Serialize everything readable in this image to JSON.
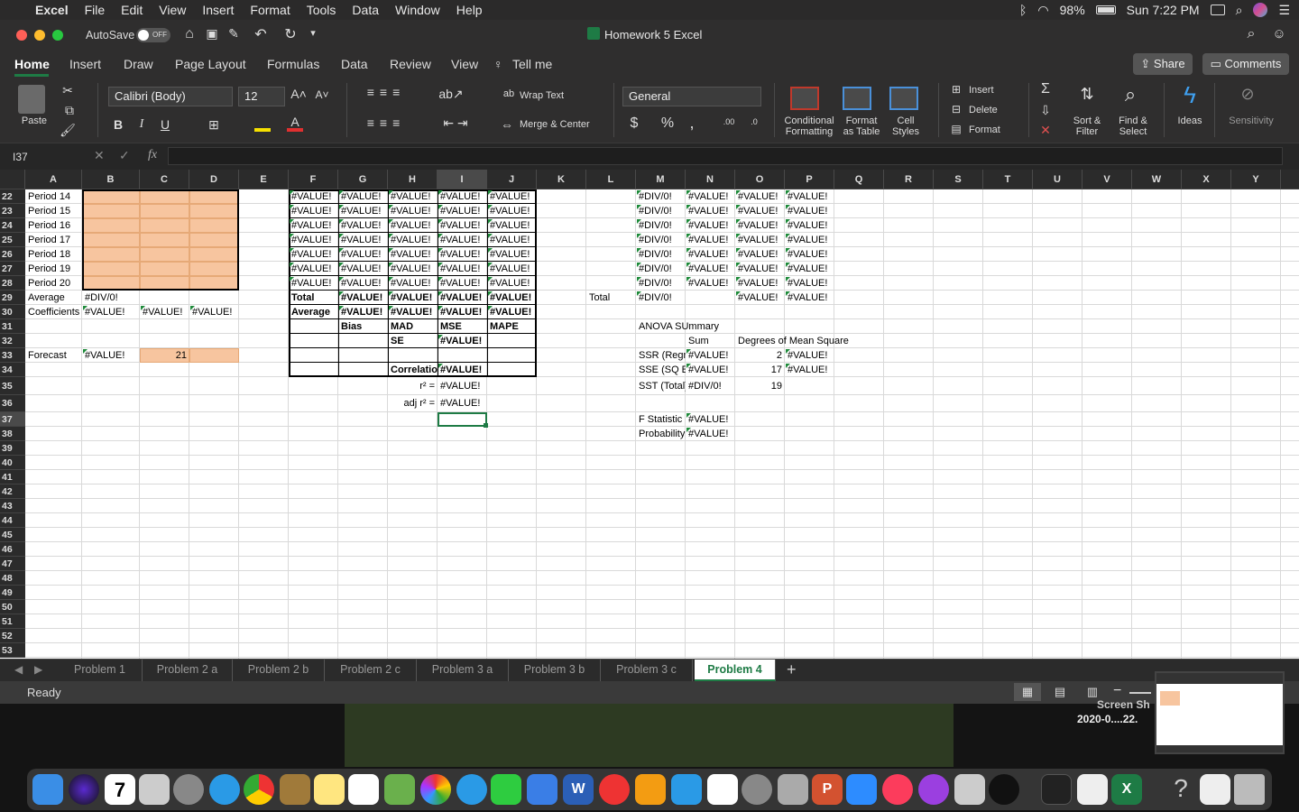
{
  "menubar": {
    "app": "Excel",
    "items": [
      "File",
      "Edit",
      "View",
      "Insert",
      "Format",
      "Tools",
      "Data",
      "Window",
      "Help"
    ],
    "battery": "98%",
    "clock": "Sun 7:22 PM"
  },
  "titlebar": {
    "autosave": "AutoSave",
    "autosave_state": "OFF",
    "title": "Homework 5 Excel"
  },
  "ribbon_tabs": [
    "Home",
    "Insert",
    "Draw",
    "Page Layout",
    "Formulas",
    "Data",
    "Review",
    "View"
  ],
  "tell_me": "Tell me",
  "share": "Share",
  "comments": "Comments",
  "ribbon": {
    "paste": "Paste",
    "font": "Calibri (Body)",
    "size": "12",
    "wrap": "Wrap Text",
    "merge": "Merge & Center",
    "numfmt": "General",
    "cond1": "Conditional",
    "cond2": "Formatting",
    "fmt1": "Format",
    "fmt2": "as Table",
    "cell1": "Cell",
    "cell2": "Styles",
    "insert": "Insert",
    "delete": "Delete",
    "format": "Format",
    "sort1": "Sort &",
    "sort2": "Filter",
    "find1": "Find &",
    "find2": "Select",
    "ideas": "Ideas",
    "sensitivity": "Sensitivity"
  },
  "formula_bar": {
    "name_box": "I37",
    "fx": "fx",
    "content": ""
  },
  "columns": [
    "A",
    "B",
    "C",
    "D",
    "E",
    "F",
    "G",
    "H",
    "I",
    "J",
    "K",
    "L",
    "M",
    "N",
    "O",
    "P",
    "Q",
    "R",
    "S",
    "T",
    "U",
    "V",
    "W",
    "X",
    "Y"
  ],
  "rows": [
    "22",
    "23",
    "24",
    "25",
    "26",
    "27",
    "28",
    "29",
    "30",
    "31",
    "32",
    "33",
    "34",
    "35",
    "36",
    "37",
    "38",
    "39",
    "40",
    "41",
    "42",
    "43",
    "44",
    "45",
    "46",
    "47",
    "48",
    "49",
    "50",
    "51",
    "52",
    "53"
  ],
  "cells": {
    "A": [
      "Period 14",
      "Period 15",
      "Period 16",
      "Period 17",
      "Period 18",
      "Period 19",
      "Period 20",
      "Average",
      "Coefficients",
      "",
      "",
      "Forecast"
    ],
    "B29": "#DIV/0!",
    "B30": "#VALUE!",
    "C30": "#VALUE!",
    "D30": "#VALUE!",
    "B33": "#VALUE!",
    "C33": "21",
    "err": "#VALUE!",
    "div": "#DIV/0!",
    "F29": "Total",
    "F30": "Average",
    "G31": "Bias",
    "H31": "MAD",
    "I31": "MSE",
    "J31": "MAPE",
    "H32": "SE",
    "I32": "#VALUE!",
    "H34": "Correlation",
    "I34": "#VALUE!",
    "H35": "r² =",
    "I35": "#VALUE!",
    "H36": "adj r² =",
    "I36": "#VALUE!",
    "L29": "Total",
    "M29": "#DIV/0!",
    "M31": "ANOVA SUmmary",
    "N32": "Sum",
    "O32": "Degrees of Mean Square",
    "M33": "SSR (Regre",
    "N33": "#VALUE!",
    "O33": "2",
    "P33": "#VALUE!",
    "M34": "SSE (SQ Er",
    "N34": "#VALUE!",
    "O34": "17",
    "P34": "#VALUE!",
    "M35": "SST (Total)",
    "N35": "#DIV/0!",
    "O35": "19",
    "M37": "F Statistic",
    "N37": "#VALUE!",
    "M38": "Probability",
    "N38": "#VALUE!"
  },
  "sheet_tabs": [
    "Problem 1",
    "Problem 2 a",
    "Problem 2 b",
    "Problem 2 c",
    "Problem 3 a",
    "Problem 3 b",
    "Problem 3 c",
    "Problem 4"
  ],
  "active_tab": "Problem 4",
  "status": "Ready",
  "desktop_file": "Screen Sh",
  "desktop_file2": "2020-0....22.",
  "dock_badge": "7",
  "colors": {
    "orange_fill": "#f7c59f",
    "active_tab": "#1e7b45",
    "error_marker": "#1e8a3a"
  }
}
